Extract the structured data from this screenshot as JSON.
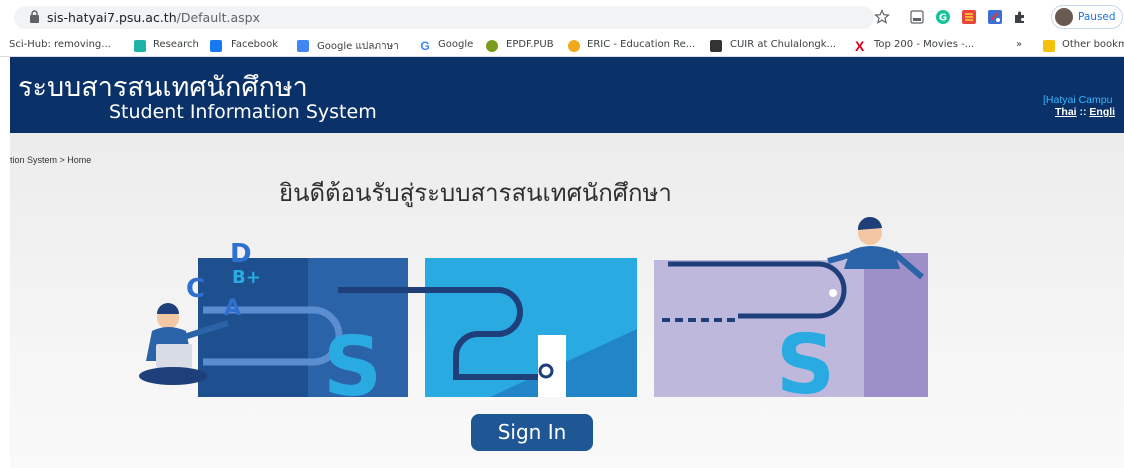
{
  "browser": {
    "url_host": "sis-hatyai7.psu.ac.th",
    "url_path": "/Default.aspx",
    "profile_status": "Paused",
    "bookmarks": [
      {
        "label": "Sci-Hub: removing...",
        "color": ""
      },
      {
        "label": "Research",
        "color": "#1fb2a6"
      },
      {
        "label": "Facebook",
        "color": "#1877f2"
      },
      {
        "label": "Google แปลภาษา",
        "color": "#4285f4"
      },
      {
        "label": "Google",
        "color": "#4285f4"
      },
      {
        "label": "EPDF.PUB",
        "color": "#7a9a1c"
      },
      {
        "label": "ERIC - Education Re...",
        "color": "#f2a81d"
      },
      {
        "label": "CUIR at Chulalongk...",
        "color": "#333333"
      },
      {
        "label": "Top 200 - Movies -...",
        "color": "#d6001c"
      }
    ],
    "overflow": "»",
    "other_bookmarks": "Other bookm"
  },
  "header": {
    "title_th": "ระบบสารสนเทศนักศึกษา",
    "title_en": "Student Information System",
    "campus": "[Hatyai Campu",
    "lang_thai": "Thai",
    "lang_sep": " :: ",
    "lang_english": "Engli"
  },
  "breadcrumb": "tion System > Home",
  "welcome": "ยินดีต้อนรับสู่ระบบสารสนเทศนักศึกษา",
  "illustration": {
    "letters": [
      "D",
      "C",
      "B+",
      "A"
    ]
  },
  "signin_label": "Sign In",
  "colors": {
    "header_bg": "#0b3268",
    "button_bg": "#1f5694",
    "accent_blue": "#29abe2"
  }
}
